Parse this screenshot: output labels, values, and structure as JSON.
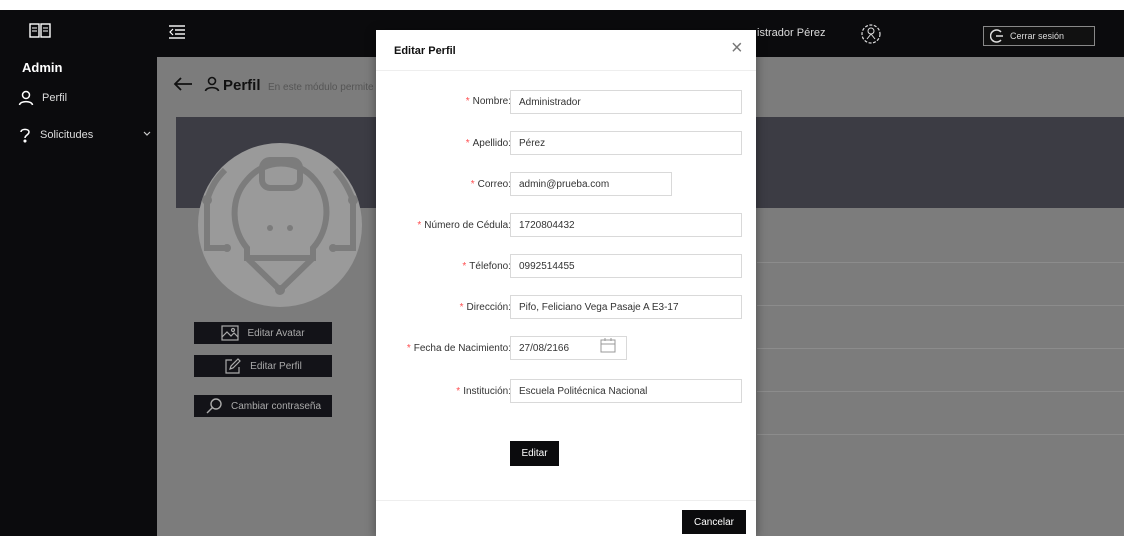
{
  "sidebar": {
    "brand": "Admin",
    "items": [
      {
        "label": "Perfil",
        "icon": "person-icon"
      },
      {
        "label": "Solicitudes",
        "icon": "question-icon"
      }
    ]
  },
  "header": {
    "username": "istrador Pérez",
    "logout_label": "Cerrar sesión"
  },
  "page": {
    "title": "Perfil",
    "description": "En este módulo permite"
  },
  "profile_actions": {
    "edit_avatar": "Editar Avatar",
    "edit_profile": "Editar Perfil",
    "change_password": "Cambiar contraseña"
  },
  "modal": {
    "title": "Editar Perfil",
    "close": "×",
    "fields": {
      "nombre": {
        "label": "Nombre:",
        "value": "Administrador"
      },
      "apellido": {
        "label": "Apellido:",
        "value": "Pérez"
      },
      "correo": {
        "label": "Correo:",
        "value": "admin@prueba.com"
      },
      "cedula": {
        "label": "Número de Cédula:",
        "value": "1720804432"
      },
      "telefono": {
        "label": "Télefono:",
        "value": "0992514455"
      },
      "direccion": {
        "label": "Dirección:",
        "value": "Pifo, Feliciano Vega Pasaje A E3-17"
      },
      "fecha": {
        "label": "Fecha de Nacimiento:",
        "value": "27/08/2166"
      },
      "institucion": {
        "label": "Institución:",
        "value": "Escuela Politécnica Nacional"
      }
    },
    "required_mark": "*",
    "submit_label": "Editar",
    "cancel_label": "Cancelar"
  },
  "colors": {
    "dark": "#0b0b0d",
    "overlay": "#7c7c7c",
    "band": "#3c3c44",
    "required": "#ff4d4f"
  }
}
